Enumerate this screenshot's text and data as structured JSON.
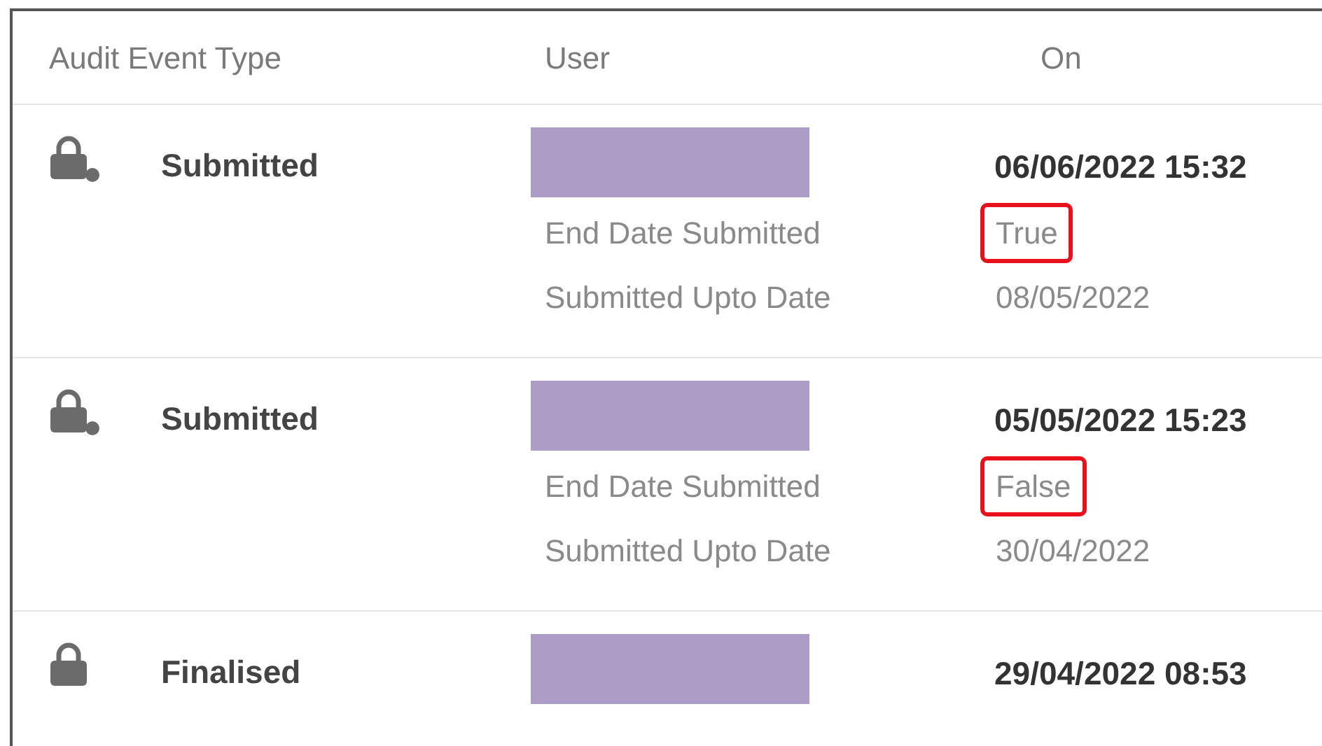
{
  "table": {
    "columns": [
      "Audit Event Type",
      "User",
      "On"
    ],
    "rows": [
      {
        "kind": "pending",
        "type": "Submitted",
        "on": "06/06/2022 15:32",
        "details": [
          {
            "label": "End Date Submitted",
            "value": "True",
            "highlighted": true
          },
          {
            "label": "Submitted Upto Date",
            "value": "08/05/2022",
            "highlighted": false
          }
        ]
      },
      {
        "kind": "pending",
        "type": "Submitted",
        "on": "05/05/2022 15:23",
        "details": [
          {
            "label": "End Date Submitted",
            "value": "False",
            "highlighted": true
          },
          {
            "label": "Submitted Upto Date",
            "value": "30/04/2022",
            "highlighted": false
          }
        ]
      },
      {
        "kind": "final",
        "type": "Finalised",
        "on": "29/04/2022 08:53"
      }
    ]
  }
}
